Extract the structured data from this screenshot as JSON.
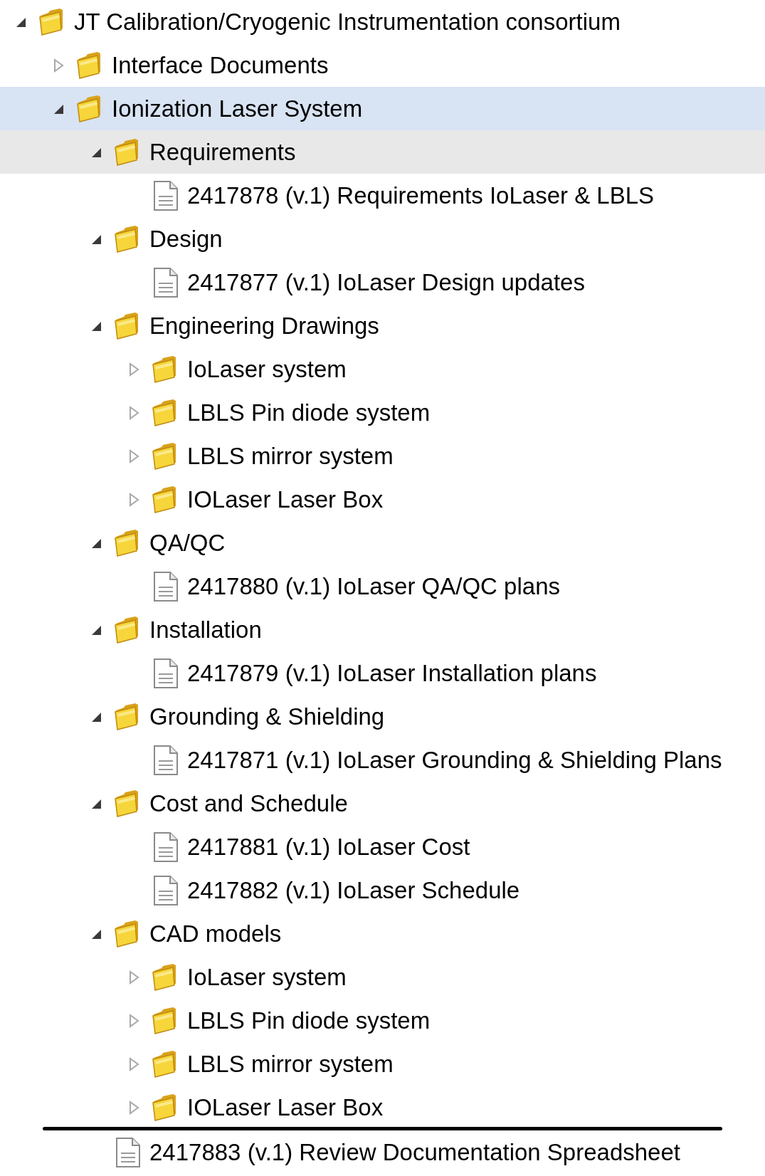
{
  "tree": [
    {
      "kind": "folder",
      "label": "JT Calibration/Cryogenic Instrumentation consortium",
      "expanded": true,
      "selected": false,
      "hovered": false,
      "children": [
        {
          "kind": "folder",
          "label": "Interface Documents",
          "expanded": false,
          "selected": false,
          "hovered": false
        },
        {
          "kind": "folder",
          "label": "Ionization Laser System",
          "expanded": true,
          "selected": true,
          "hovered": false,
          "children": [
            {
              "kind": "folder",
              "label": "Requirements",
              "expanded": true,
              "selected": false,
              "hovered": true,
              "children": [
                {
                  "kind": "document",
                  "label": "2417878 (v.1) Requirements IoLaser & LBLS",
                  "selected": false,
                  "hovered": false
                }
              ]
            },
            {
              "kind": "folder",
              "label": "Design",
              "expanded": true,
              "selected": false,
              "hovered": false,
              "children": [
                {
                  "kind": "document",
                  "label": "2417877 (v.1) IoLaser Design updates",
                  "selected": false,
                  "hovered": false
                }
              ]
            },
            {
              "kind": "folder",
              "label": "Engineering Drawings",
              "expanded": true,
              "selected": false,
              "hovered": false,
              "children": [
                {
                  "kind": "folder",
                  "label": "IoLaser system",
                  "expanded": false,
                  "selected": false,
                  "hovered": false
                },
                {
                  "kind": "folder",
                  "label": "LBLS Pin diode system",
                  "expanded": false,
                  "selected": false,
                  "hovered": false
                },
                {
                  "kind": "folder",
                  "label": "LBLS mirror system",
                  "expanded": false,
                  "selected": false,
                  "hovered": false
                },
                {
                  "kind": "folder",
                  "label": "IOLaser Laser Box",
                  "expanded": false,
                  "selected": false,
                  "hovered": false
                }
              ]
            },
            {
              "kind": "folder",
              "label": "QA/QC",
              "expanded": true,
              "selected": false,
              "hovered": false,
              "children": [
                {
                  "kind": "document",
                  "label": "2417880 (v.1) IoLaser QA/QC plans",
                  "selected": false,
                  "hovered": false
                }
              ]
            },
            {
              "kind": "folder",
              "label": "Installation",
              "expanded": true,
              "selected": false,
              "hovered": false,
              "children": [
                {
                  "kind": "document",
                  "label": "2417879 (v.1) IoLaser Installation plans",
                  "selected": false,
                  "hovered": false
                }
              ]
            },
            {
              "kind": "folder",
              "label": "Grounding & Shielding",
              "expanded": true,
              "selected": false,
              "hovered": false,
              "children": [
                {
                  "kind": "document",
                  "label": "2417871 (v.1) IoLaser Grounding & Shielding Plans",
                  "selected": false,
                  "hovered": false
                }
              ]
            },
            {
              "kind": "folder",
              "label": "Cost and Schedule",
              "expanded": true,
              "selected": false,
              "hovered": false,
              "children": [
                {
                  "kind": "document",
                  "label": "2417881 (v.1) IoLaser Cost",
                  "selected": false,
                  "hovered": false
                },
                {
                  "kind": "document",
                  "label": "2417882 (v.1) IoLaser Schedule",
                  "selected": false,
                  "hovered": false
                }
              ]
            },
            {
              "kind": "folder",
              "label": "CAD models",
              "expanded": true,
              "selected": false,
              "hovered": false,
              "children": [
                {
                  "kind": "folder",
                  "label": "IoLaser system",
                  "expanded": false,
                  "selected": false,
                  "hovered": false
                },
                {
                  "kind": "folder",
                  "label": "LBLS Pin diode system",
                  "expanded": false,
                  "selected": false,
                  "hovered": false
                },
                {
                  "kind": "folder",
                  "label": "LBLS mirror system",
                  "expanded": false,
                  "selected": false,
                  "hovered": false
                },
                {
                  "kind": "folder",
                  "label": "IOLaser Laser Box",
                  "expanded": false,
                  "selected": false,
                  "hovered": false
                }
              ]
            },
            {
              "kind": "document",
              "label": "2417883 (v.1) Review Documentation Spreadsheet",
              "selected": false,
              "hovered": false,
              "torn_edge_above": true
            }
          ]
        }
      ]
    }
  ]
}
